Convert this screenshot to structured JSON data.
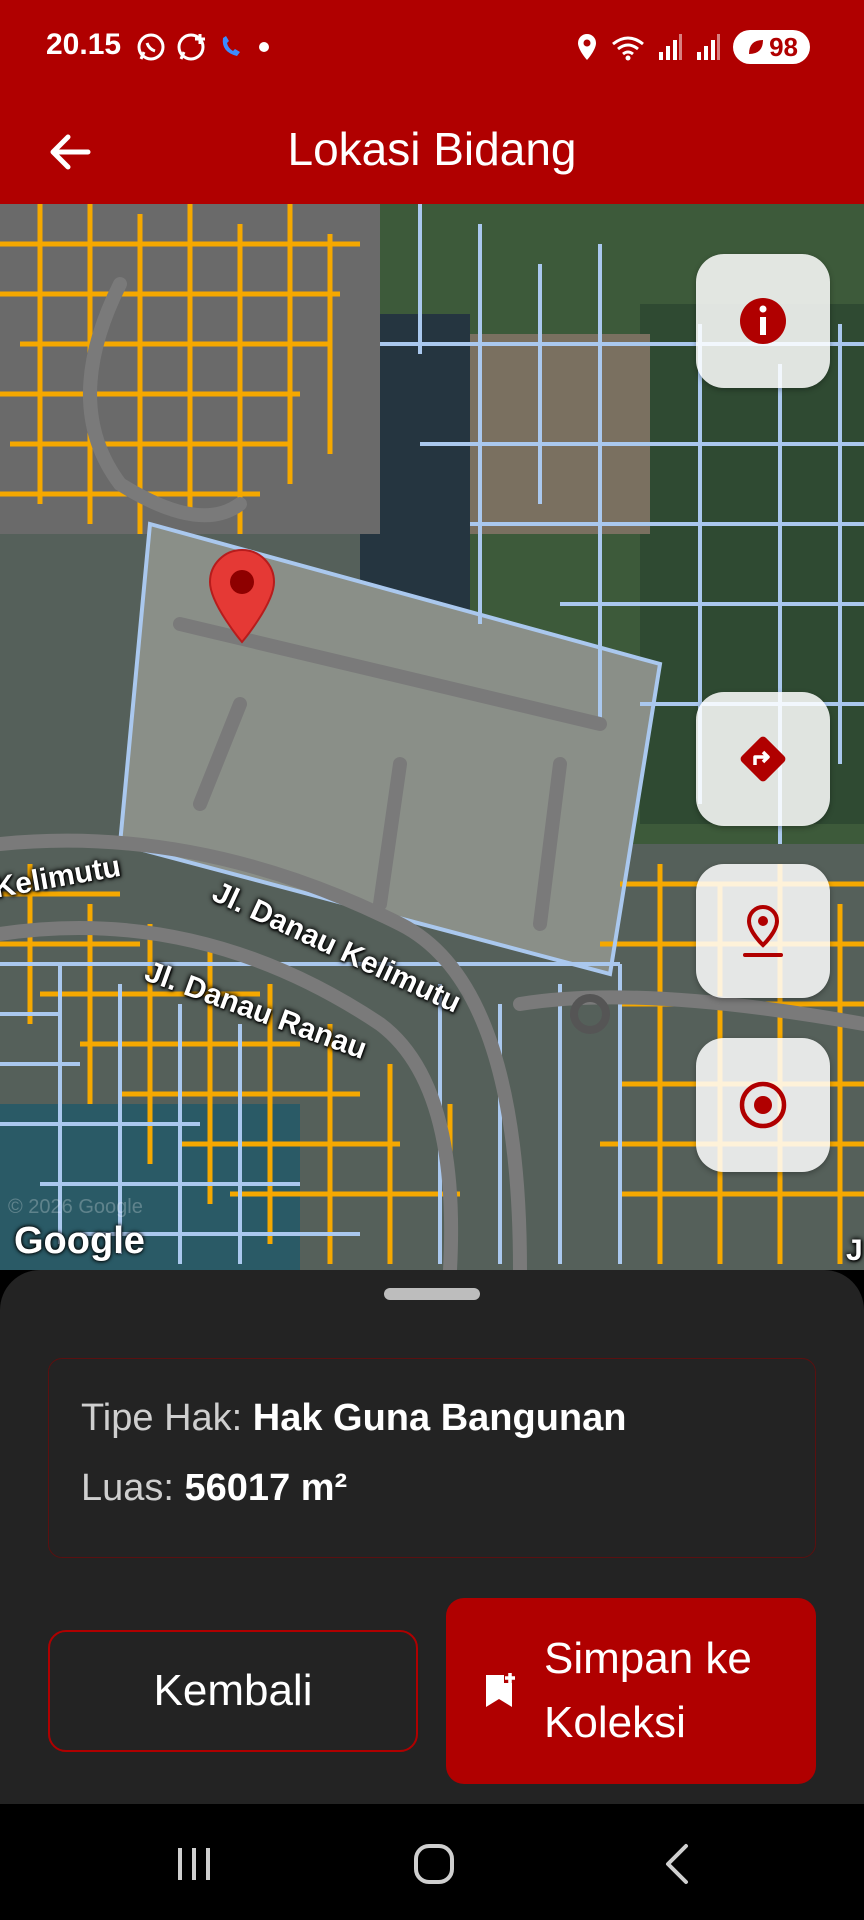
{
  "status_bar": {
    "time": "20.15",
    "battery": "98",
    "icons_left": [
      "whatsapp-icon",
      "whatsapp-business-icon",
      "phone-call-icon",
      "dot-icon"
    ],
    "icons_right": [
      "location-icon",
      "wifi-icon",
      "signal-icon",
      "signal-icon",
      "battery-icon"
    ]
  },
  "app_bar": {
    "title": "Lokasi Bidang",
    "back_icon": "arrow-left-icon"
  },
  "map": {
    "road_labels": [
      "Kelimutu",
      "Jl. Danau Kelimutu",
      "Jl. Danau Ranau",
      "J"
    ],
    "attribution": "Google",
    "watermark": "© 2026 Google",
    "marker_icon": "map-pin-icon",
    "buttons": [
      {
        "name": "info",
        "icon": "info-icon"
      },
      {
        "name": "directions",
        "icon": "directions-icon"
      },
      {
        "name": "location",
        "icon": "location-pin-icon"
      },
      {
        "name": "my-location",
        "icon": "target-icon"
      }
    ]
  },
  "sheet": {
    "tipe_hak_label": "Tipe Hak: ",
    "tipe_hak_value": "Hak Guna Bangunan",
    "luas_label": "Luas: ",
    "luas_value": "56017 m²",
    "back_button": "Kembali",
    "save_button": "Simpan ke Koleksi",
    "save_icon": "bookmark-add-icon"
  },
  "nav_bar": {
    "items": [
      "recent-apps-icon",
      "home-icon",
      "back-icon"
    ]
  },
  "colors": {
    "primary": "#b00000",
    "sheet_bg": "#232323",
    "parcel_outline": "#aac8ee",
    "parcel_orange": "#f5a800"
  }
}
